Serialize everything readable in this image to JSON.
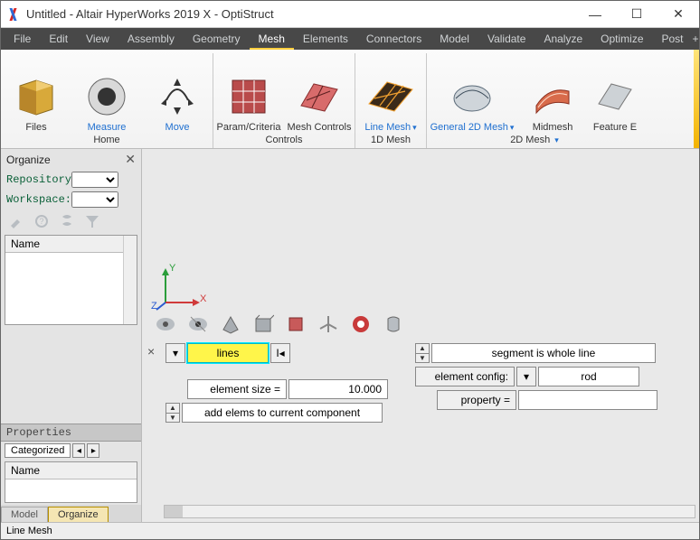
{
  "title": "Untitled - Altair HyperWorks 2019 X - OptiStruct",
  "menu": {
    "items": [
      "File",
      "Edit",
      "View",
      "Assembly",
      "Geometry",
      "Mesh",
      "Elements",
      "Connectors",
      "Model",
      "Validate",
      "Analyze",
      "Optimize",
      "Post"
    ],
    "active": "Mesh"
  },
  "ribbon": {
    "groups": [
      {
        "name": "Home",
        "buttons": [
          {
            "label": "Files",
            "icon": "files",
            "blue": false
          },
          {
            "label": "Measure",
            "icon": "measure",
            "blue": true
          },
          {
            "label": "Move",
            "icon": "move",
            "blue": true
          }
        ]
      },
      {
        "name": "Controls",
        "buttons": [
          {
            "label": "Param/Criteria",
            "icon": "param",
            "blue": false
          },
          {
            "label": "Mesh Controls",
            "icon": "meshctrl",
            "blue": false
          }
        ]
      },
      {
        "name": "1D Mesh",
        "buttons": [
          {
            "label": "Line Mesh",
            "icon": "linemesh",
            "blue": true
          }
        ]
      },
      {
        "name": "2D Mesh",
        "buttons": [
          {
            "label": "General 2D Mesh",
            "icon": "gen2d",
            "blue": true
          },
          {
            "label": "Midmesh",
            "icon": "midmesh",
            "blue": false
          },
          {
            "label": "Feature E",
            "icon": "feat",
            "blue": false
          }
        ]
      }
    ]
  },
  "organize": {
    "title": "Organize",
    "repo_label": "Repository:",
    "ws_label": "Workspace:",
    "list_header": "Name",
    "properties": "Properties",
    "categorized": "Categorized",
    "name2": "Name",
    "tabs": [
      "Model",
      "Organize"
    ],
    "active_tab": "Organize"
  },
  "axes": {
    "x": "X",
    "y": "Y",
    "z": "Z"
  },
  "panel": {
    "lines": "lines",
    "elem_size_label": "element size =",
    "elem_size_value": "10.000",
    "add_elems": "add elems to current component",
    "segment": "segment is whole line",
    "elem_config": "element config:",
    "rod": "rod",
    "property": "property ="
  },
  "status": "Line Mesh"
}
